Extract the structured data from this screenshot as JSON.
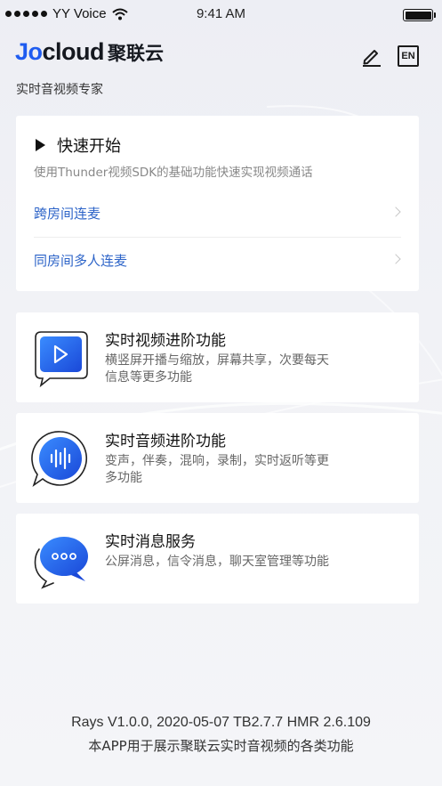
{
  "status_bar": {
    "carrier": "YY Voice",
    "time": "9:41 AM",
    "signal_icon": "signal-dots-icon",
    "wifi_icon": "wifi-icon",
    "battery_icon": "battery-icon"
  },
  "header": {
    "logo_part1": "Jo",
    "logo_part2": "cloud",
    "logo_cn": "聚联云",
    "subtitle": "实时音视频专家",
    "edit_icon": "edit-pencil-icon",
    "lang_label": "EN"
  },
  "quick_start": {
    "title": "快速开始",
    "description": "使用Thunder视频SDK的基础功能快速实现视频通话",
    "items": [
      {
        "label": "跨房间连麦"
      },
      {
        "label": "同房间多人连麦"
      }
    ]
  },
  "features": [
    {
      "title": "实时视频进阶功能",
      "description": "横竖屏开播与缩放，屏幕共享，次要每天信息等更多功能",
      "icon": "video-play-icon"
    },
    {
      "title": "实时音频进阶功能",
      "description": "变声，伴奏，混响，录制，实时返听等更多功能",
      "icon": "audio-wave-icon"
    },
    {
      "title": "实时消息服务",
      "description": "公屏消息，信令消息，聊天室管理等功能",
      "icon": "chat-bubble-icon"
    }
  ],
  "footer": {
    "version": "Rays V1.0.0, 2020-05-07 TB2.7.7 HMR 2.6.109",
    "description": "本APP用于展示聚联云实时音视频的各类功能"
  },
  "colors": {
    "brand_blue": "#1f5cf0",
    "link_blue": "#2d64c8",
    "background": "#eff0f5"
  }
}
